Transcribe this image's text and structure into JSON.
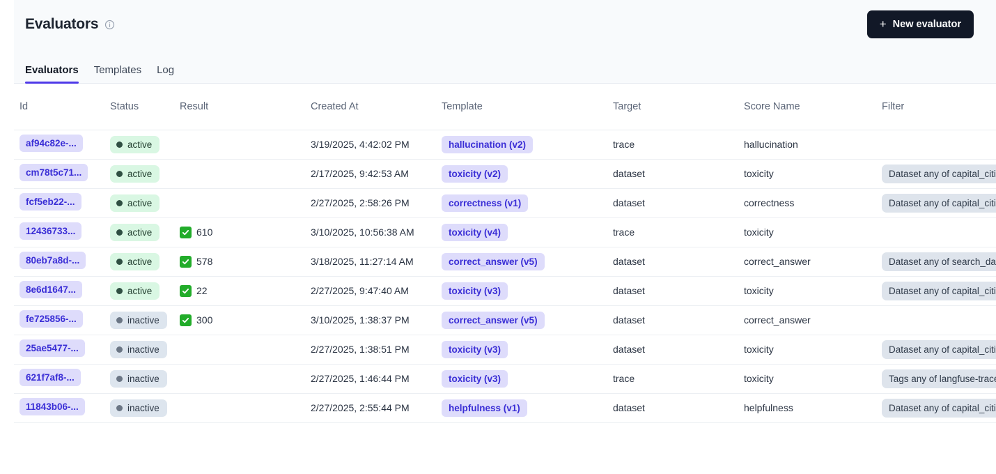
{
  "header": {
    "title": "Evaluators",
    "info_icon": "info-circle-icon",
    "new_evaluator_label": "New evaluator",
    "plus_glyph": "+"
  },
  "tabs": [
    {
      "label": "Evaluators",
      "active": true
    },
    {
      "label": "Templates",
      "active": false
    },
    {
      "label": "Log",
      "active": false
    }
  ],
  "table": {
    "columns": [
      "Id",
      "Status",
      "Result",
      "Created At",
      "Template",
      "Target",
      "Score Name",
      "Filter"
    ],
    "rows": [
      {
        "id": "af94c82e-...",
        "status": "active",
        "result": "",
        "created_at": "3/19/2025, 4:42:02 PM",
        "template": "hallucination (v2)",
        "target": "trace",
        "score_name": "hallucination",
        "filter": ""
      },
      {
        "id": "cm78t5c71...",
        "status": "active",
        "result": "",
        "created_at": "2/17/2025, 9:42:53 AM",
        "template": "toxicity (v2)",
        "target": "dataset",
        "score_name": "toxicity",
        "filter": "Dataset any of capital_cities"
      },
      {
        "id": "fcf5eb22-...",
        "status": "active",
        "result": "",
        "created_at": "2/27/2025, 2:58:26 PM",
        "template": "correctness (v1)",
        "target": "dataset",
        "score_name": "correctness",
        "filter": "Dataset any of capital_cities"
      },
      {
        "id": "12436733...",
        "status": "active",
        "result": "610",
        "created_at": "3/10/2025, 10:56:38 AM",
        "template": "toxicity (v4)",
        "target": "trace",
        "score_name": "toxicity",
        "filter": ""
      },
      {
        "id": "80eb7a8d-...",
        "status": "active",
        "result": "578",
        "created_at": "3/18/2025, 11:27:14 AM",
        "template": "correct_answer (v5)",
        "target": "dataset",
        "score_name": "correct_answer",
        "filter": "Dataset any of search_dataset"
      },
      {
        "id": "8e6d1647...",
        "status": "active",
        "result": "22",
        "created_at": "2/27/2025, 9:47:40 AM",
        "template": "toxicity (v3)",
        "target": "dataset",
        "score_name": "toxicity",
        "filter": "Dataset any of capital_cities"
      },
      {
        "id": "fe725856-...",
        "status": "inactive",
        "result": "300",
        "created_at": "3/10/2025, 1:38:37 PM",
        "template": "correct_answer (v5)",
        "target": "dataset",
        "score_name": "correct_answer",
        "filter": ""
      },
      {
        "id": "25ae5477-...",
        "status": "inactive",
        "result": "",
        "created_at": "2/27/2025, 1:38:51 PM",
        "template": "toxicity (v3)",
        "target": "dataset",
        "score_name": "toxicity",
        "filter": "Dataset any of capital_cities"
      },
      {
        "id": "621f7af8-...",
        "status": "inactive",
        "result": "",
        "created_at": "2/27/2025, 1:46:44 PM",
        "template": "toxicity (v3)",
        "target": "trace",
        "score_name": "toxicity",
        "filter": "Tags any of langfuse-trace"
      },
      {
        "id": "11843b06-...",
        "status": "inactive",
        "result": "",
        "created_at": "2/27/2025, 2:55:44 PM",
        "template": "helpfulness (v1)",
        "target": "dataset",
        "score_name": "helpfulness",
        "filter": "Dataset any of capital_cities"
      }
    ]
  },
  "colors": {
    "accent": "#4f39e8",
    "badge_bg": "#dedcfb",
    "badge_text": "#3a2ed6",
    "status_active_bg": "#d9f7e3",
    "status_inactive_bg": "#dde5ee",
    "filter_bg": "#dee4ec",
    "check_green": "#22ac2a",
    "button_bg": "#111827",
    "header_bg": "#f8fafc"
  }
}
